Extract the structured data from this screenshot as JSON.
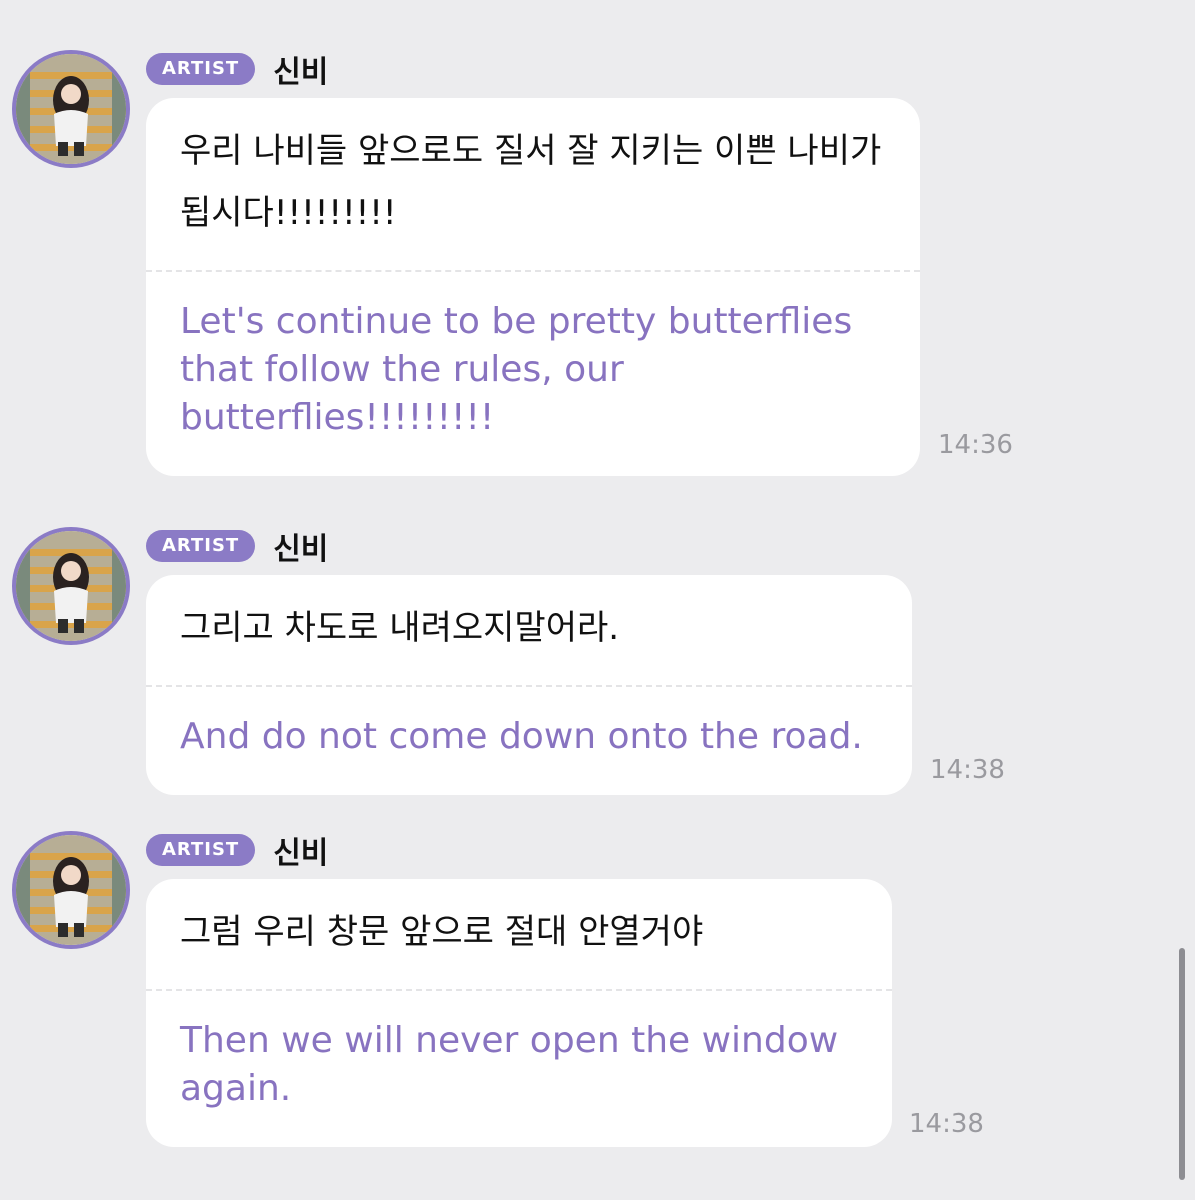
{
  "theme": {
    "background": "#ececee",
    "accent": "#8b7bc6",
    "translation_color": "#8873c0",
    "timestamp_color": "#9a9a9f"
  },
  "messages": [
    {
      "badge": "ARTIST",
      "sender": "신비",
      "avatar_icon": "profile-photo",
      "text_ko": "우리 나비들 앞으로도 질서 잘 지키는 이쁜 나비가 됩시다!!!!!!!!!",
      "text_en": "Let's continue to be pretty butterflies that follow the rules, our butterflies!!!!!!!!!",
      "time": "14:36"
    },
    {
      "badge": "ARTIST",
      "sender": "신비",
      "avatar_icon": "profile-photo",
      "text_ko": "그리고 차도로 내려오지말어라.",
      "text_en": "And do not come down onto the road.",
      "time": "14:38"
    },
    {
      "badge": "ARTIST",
      "sender": "신비",
      "avatar_icon": "profile-photo",
      "text_ko": "그럼 우리 창문 앞으로 절대 안열거야",
      "text_en": "Then we will never open the window again.",
      "time": "14:38"
    }
  ]
}
